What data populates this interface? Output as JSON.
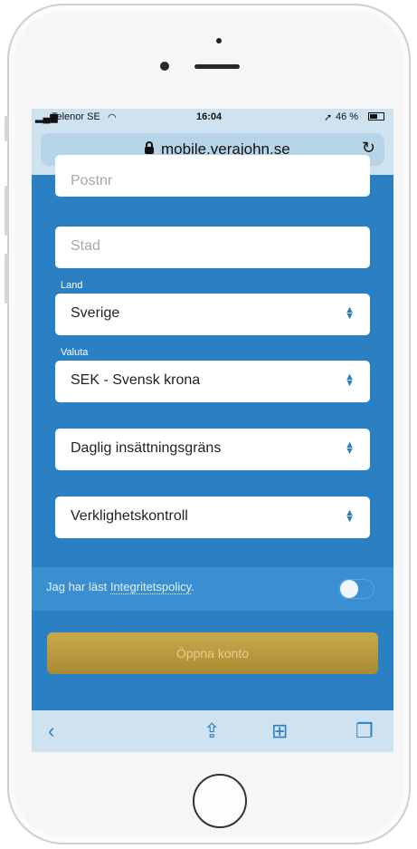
{
  "status_bar": {
    "carrier": "Telenor SE",
    "time": "16:04",
    "battery": "46 %"
  },
  "browser": {
    "url": "mobile.verajohn.se"
  },
  "form": {
    "postnr_placeholder": "Postnr",
    "stad_placeholder": "Stad",
    "land_label": "Land",
    "land_value": "Sverige",
    "valuta_label": "Valuta",
    "valuta_value": "SEK - Svensk krona",
    "deposit_limit": "Daglig insättningsgräns",
    "reality_check": "Verklighetskontroll",
    "consent_prefix": "Jag har läst ",
    "consent_link": "Integritetspolicy",
    "consent_suffix": ".",
    "submit_label": "Öppna konto"
  },
  "icons": [
    "lock-icon",
    "reload-icon",
    "back-icon",
    "share-icon",
    "bookmarks-icon",
    "tabs-icon",
    "select-arrows-icon"
  ],
  "colors": {
    "page_bg": "#2b80c4",
    "button": "#b8993d",
    "bars": "#cfe2f0"
  }
}
